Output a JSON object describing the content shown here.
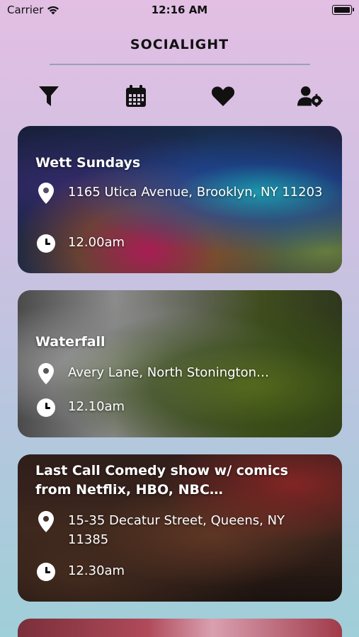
{
  "status_bar": {
    "carrier": "Carrier",
    "time": "12:16 AM"
  },
  "app": {
    "title": "SOCIALIGHT"
  },
  "toolbar": {
    "icons": [
      "filter-icon",
      "calendar-icon",
      "heart-icon",
      "user-settings-icon"
    ]
  },
  "events": [
    {
      "title": "Wett Sundays",
      "address": "1165 Utica Avenue, Brooklyn, NY 11203",
      "time": "12.00am"
    },
    {
      "title": "Waterfall",
      "address": "Avery Lane, North Stonington…",
      "time": "12.10am"
    },
    {
      "title": "Last Call Comedy show w/ comics from Netflix, HBO, NBC…",
      "address": "15-35 Decatur Street, Queens, NY 11385",
      "time": "12.30am"
    }
  ],
  "colors": {
    "accent": "#111111",
    "card_text": "#ffffff"
  }
}
